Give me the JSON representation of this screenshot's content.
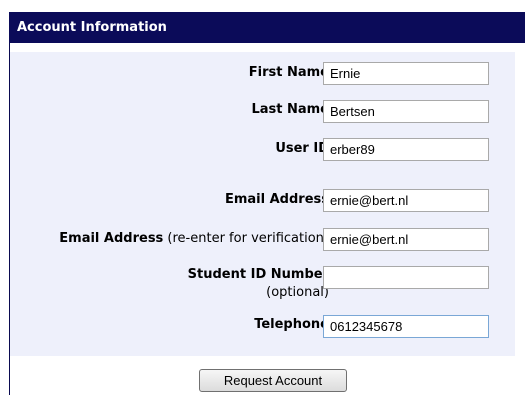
{
  "header": {
    "title": "Account Information"
  },
  "form": {
    "first_name": {
      "label": "First Name",
      "value": "Ernie"
    },
    "last_name": {
      "label": "Last Name",
      "value": "Bertsen"
    },
    "user_id": {
      "label": "User ID",
      "value": "erber89"
    },
    "email": {
      "label": "Email Address",
      "value": "ernie@bert.nl"
    },
    "email_confirm": {
      "label": "Email Address",
      "hint": " (re-enter for verification)",
      "value": "ernie@bert.nl"
    },
    "student_id": {
      "label": "Student ID Number",
      "hint": "(optional)",
      "value": ""
    },
    "telephone": {
      "label": "Telephone",
      "value": "0612345678"
    }
  },
  "actions": {
    "submit_label": "Request Account"
  }
}
